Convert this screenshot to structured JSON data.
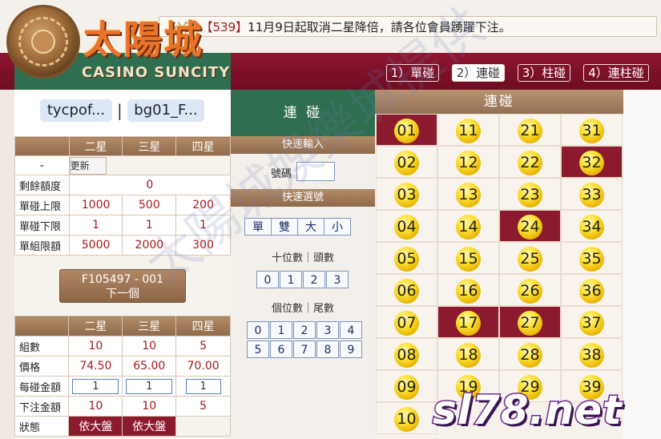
{
  "notice": {
    "faded": "公告：",
    "number": "【539】",
    "text": "11月9日起取消二星降倍，請各位會員踴躍下注。"
  },
  "logo": {
    "cn": "太陽城",
    "en": "CASINO SUNCITY"
  },
  "tabs": [
    {
      "label": "1）單碰"
    },
    {
      "label": "2）連碰"
    },
    {
      "label": "3）柱碰"
    },
    {
      "label": "4）連柱碰"
    }
  ],
  "users": {
    "left": "tycpof...",
    "sep": "|",
    "right": "bg01_F..."
  },
  "limits": {
    "headers": [
      "",
      "二星",
      "三星",
      "四星"
    ],
    "update_row": {
      "label": "-",
      "button": "更新"
    },
    "rows": [
      {
        "label": "剩餘額度",
        "merged": "0"
      },
      {
        "label": "單碰上限",
        "c2": "1000",
        "c3": "500",
        "c4": "200"
      },
      {
        "label": "單碰下限",
        "c2": "1",
        "c3": "1",
        "c4": "1"
      },
      {
        "label": "單組限額",
        "c2": "5000",
        "c3": "2000",
        "c4": "300"
      }
    ]
  },
  "next": {
    "code": "F105497 - 001",
    "label": "下一個"
  },
  "bet": {
    "headers": [
      "",
      "二星",
      "三星",
      "四星"
    ],
    "rows": [
      {
        "label": "組數",
        "c2": "10",
        "c3": "10",
        "c4": "5"
      },
      {
        "label": "價格",
        "c2": "74.50",
        "c3": "65.00",
        "c4": "70.00"
      },
      {
        "label": "每碰金額",
        "c2": "1",
        "c3": "1",
        "c4": "1"
      },
      {
        "label": "下注金額",
        "c2": "10",
        "c3": "10",
        "c4": "5"
      },
      {
        "label": "狀態",
        "c2": "依大盤",
        "c3": "依大盤",
        "c4": ""
      }
    ]
  },
  "mid": {
    "title": "連 碰",
    "quick_input": "快速輸入",
    "number_label": "號碼",
    "quick_select": "快速選號",
    "qbuttons": [
      "單",
      "雙",
      "大",
      "小"
    ],
    "tens_label": "十位數｜頭數",
    "tens": [
      "0",
      "1",
      "2",
      "3"
    ],
    "units_label": "個位數｜尾數",
    "units_row1": [
      "0",
      "1",
      "2",
      "3",
      "4"
    ],
    "units_row2": [
      "5",
      "6",
      "7",
      "8",
      "9"
    ]
  },
  "numbers": {
    "title": "連碰",
    "balls": [
      "01",
      "11",
      "21",
      "31",
      "02",
      "12",
      "22",
      "32",
      "03",
      "13",
      "23",
      "33",
      "04",
      "14",
      "24",
      "34",
      "05",
      "15",
      "25",
      "35",
      "06",
      "16",
      "26",
      "36",
      "07",
      "17",
      "27",
      "37",
      "08",
      "18",
      "28",
      "38",
      "09",
      "19",
      "29",
      "39",
      "10"
    ],
    "selected": [
      "01",
      "32",
      "24",
      "17",
      "27"
    ]
  },
  "watermark": "太陽城娛樂城提供",
  "site": "sl78.net"
}
